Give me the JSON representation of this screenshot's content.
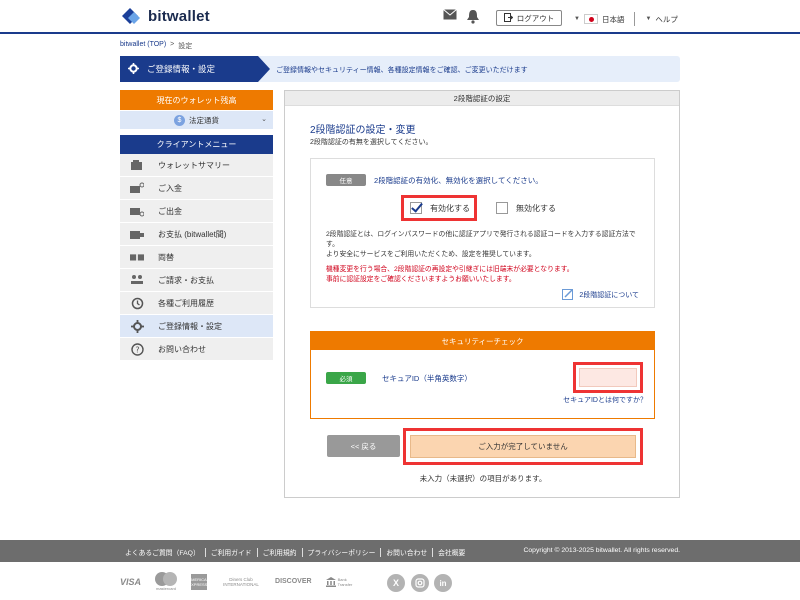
{
  "header": {
    "brand": "bitwallet",
    "logout_label": "ログアウト",
    "language": "日本語",
    "help": "ヘルプ"
  },
  "breadcrumb": {
    "home": "bitwallet (TOP)",
    "separator": ">",
    "current": "設定"
  },
  "titlebar": {
    "title": "ご登録情報・設定",
    "description": "ご登録情報やセキュリティー情報、各種設定情報をご確認、ご変更いただけます"
  },
  "sidebar": {
    "balance_header": "現在のウォレット残高",
    "currency": "法定通貨",
    "currency_symbol": "$",
    "menu_header": "クライアントメニュー",
    "items": [
      {
        "label": "ウォレットサマリー",
        "icon": "wallet-icon"
      },
      {
        "label": "ご入金",
        "icon": "deposit-icon"
      },
      {
        "label": "ご出金",
        "icon": "withdraw-icon"
      },
      {
        "label": "お支払 (bitwallet間)",
        "icon": "payment-icon"
      },
      {
        "label": "両替",
        "icon": "exchange-icon"
      },
      {
        "label": "ご請求・お支払",
        "icon": "invoice-icon"
      },
      {
        "label": "各種ご利用履歴",
        "icon": "history-icon"
      },
      {
        "label": "ご登録情報・設定",
        "icon": "gear-icon"
      },
      {
        "label": "お問い合わせ",
        "icon": "question-icon"
      }
    ]
  },
  "panel": {
    "header": "2段階認証の設定",
    "title": "2段階認証の設定・変更",
    "subtitle": "2段階認証の有無を選択してください。",
    "optional_tag": "任意",
    "select_label": "2段階認証の有効化、無効化を選択してください。",
    "enable_label": "有効化する",
    "disable_label": "無効化する",
    "description_1": "2段階認証とは、ログインパスワードの他に認証アプリで発行される認証コードを入力する認証方法です。",
    "description_2": "より安全にサービスをご利用いただくため、設定を推奨しています。",
    "warning_1": "機種変更を行う場合、2段階認証の再設定や引継ぎには旧端末が必要となります。",
    "warning_2": "事前に認証設定をご確認くださいますようお願いいたします。",
    "about_link": "2段階認証について",
    "security_header": "セキュリティーチェック",
    "required_tag": "必須",
    "secure_id_label": "セキュアID（半角英数字）",
    "secure_id_value": "",
    "secure_id_help": "セキュアIDとは何ですか？",
    "back_label": "<< 戻る",
    "submit_label": "ご入力が完了していません",
    "note": "未入力（未選択）の項目があります。"
  },
  "footer": {
    "links": [
      "よくあるご質問（FAQ）",
      "ご利用ガイド",
      "ご利用規約",
      "プライバシーポリシー",
      "お問い合わせ",
      "会社概要"
    ],
    "copyright": "Copyright © 2013-2025 bitwallet. All rights reserved.",
    "payments": [
      "VISA",
      "mastercard",
      "AMERICAN EXPRESS",
      "Diners Club INTERNATIONAL",
      "DISCOVER",
      "Bank Transfer"
    ],
    "social": [
      "X",
      "Instagram",
      "LinkedIn"
    ]
  },
  "colors": {
    "navy": "#1a3b8c",
    "orange": "#ee7a00",
    "highlight_red": "#ee3333",
    "required_green": "#3aa648"
  }
}
